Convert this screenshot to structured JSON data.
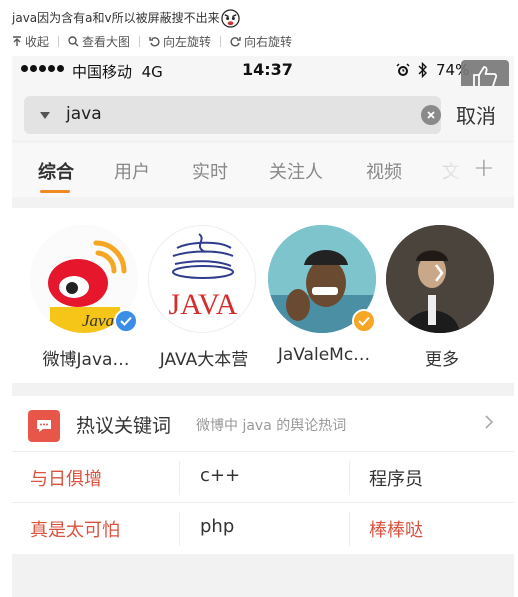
{
  "post": {
    "caption": "java因为含有a和v所以被屏蔽搜不出来",
    "emoji_icon": "angry-face-emoji",
    "toolbar": [
      {
        "label": "收起",
        "icon": "collapse-icon"
      },
      {
        "label": "查看大图",
        "icon": "magnify-icon"
      },
      {
        "label": "向左旋转",
        "icon": "rotate-left-icon"
      },
      {
        "label": "向右旋转",
        "icon": "rotate-right-icon"
      }
    ]
  },
  "status_bar": {
    "carrier": "中国移动",
    "network": "4G",
    "time": "14:37",
    "battery": "74%"
  },
  "search": {
    "query": "java",
    "cancel_label": "取消"
  },
  "tabs": [
    {
      "label": "综合",
      "active": true
    },
    {
      "label": "用户",
      "active": false
    },
    {
      "label": "实时",
      "active": false
    },
    {
      "label": "关注人",
      "active": false
    },
    {
      "label": "视频",
      "active": false
    },
    {
      "label": "文",
      "active": false
    }
  ],
  "users": [
    {
      "name": "微博Java…",
      "verified": true,
      "badge_color": "#3a8ee6"
    },
    {
      "name": "JAVA大本营",
      "verified": false
    },
    {
      "name": "JaValeMc…",
      "verified": true,
      "badge_color": "#f5a623"
    },
    {
      "name": "更多",
      "verified": false
    }
  ],
  "hot_topics": {
    "title": "热议关键词",
    "subtitle": "微博中 java 的舆论热词",
    "keywords": [
      [
        {
          "text": "与日俱增",
          "color": "#d9533f"
        },
        {
          "text": "c++",
          "color": "#333333"
        },
        {
          "text": "程序员",
          "color": "#333333"
        }
      ],
      [
        {
          "text": "真是太可怕",
          "color": "#d9533f"
        },
        {
          "text": "php",
          "color": "#333333"
        },
        {
          "text": "棒棒哒",
          "color": "#d9533f"
        }
      ]
    ]
  },
  "colors": {
    "accent_orange": "#f08a22",
    "hot_red": "#e8564a"
  }
}
